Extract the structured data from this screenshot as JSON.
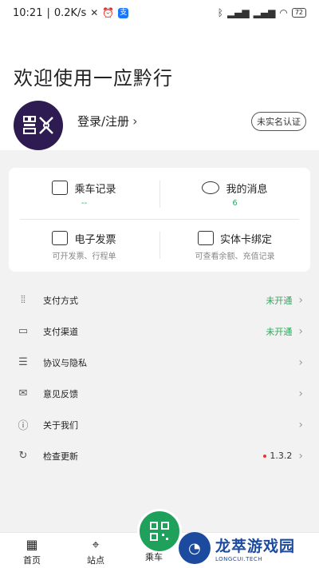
{
  "status_bar": {
    "time": "10:21",
    "speed": "0.2K/s",
    "battery": "72"
  },
  "header": {
    "welcome": "欢迎使用一应黔行",
    "login_label": "登录/注册",
    "verify_label": "未实名认证"
  },
  "card": {
    "ride_records": {
      "label": "乘车记录",
      "sub": "--"
    },
    "messages": {
      "label": "我的消息",
      "sub": "6"
    },
    "e_invoice": {
      "label": "电子发票",
      "sub": "可开发票、行程单"
    },
    "card_bind": {
      "label": "实体卡绑定",
      "sub": "可查看余额、充值记录"
    }
  },
  "menu": [
    {
      "label": "支付方式",
      "value": "未开通",
      "icon": "scan-icon"
    },
    {
      "label": "支付渠道",
      "value": "未开通",
      "icon": "card-icon"
    },
    {
      "label": "协议与隐私",
      "value": "",
      "icon": "document-icon"
    },
    {
      "label": "意见反馈",
      "value": "",
      "icon": "mail-icon"
    },
    {
      "label": "关于我们",
      "value": "",
      "icon": "info-icon"
    },
    {
      "label": "检查更新",
      "value": "1.3.2",
      "icon": "refresh-icon"
    }
  ],
  "bottom_nav": {
    "home": "首页",
    "stations": "站点",
    "ride": "乘车"
  },
  "watermark": {
    "title": "龙萃游戏园",
    "sub": "LONGCUI.TECH"
  },
  "colors": {
    "accent": "#1fa15c",
    "status_green": "#2ea55a"
  }
}
